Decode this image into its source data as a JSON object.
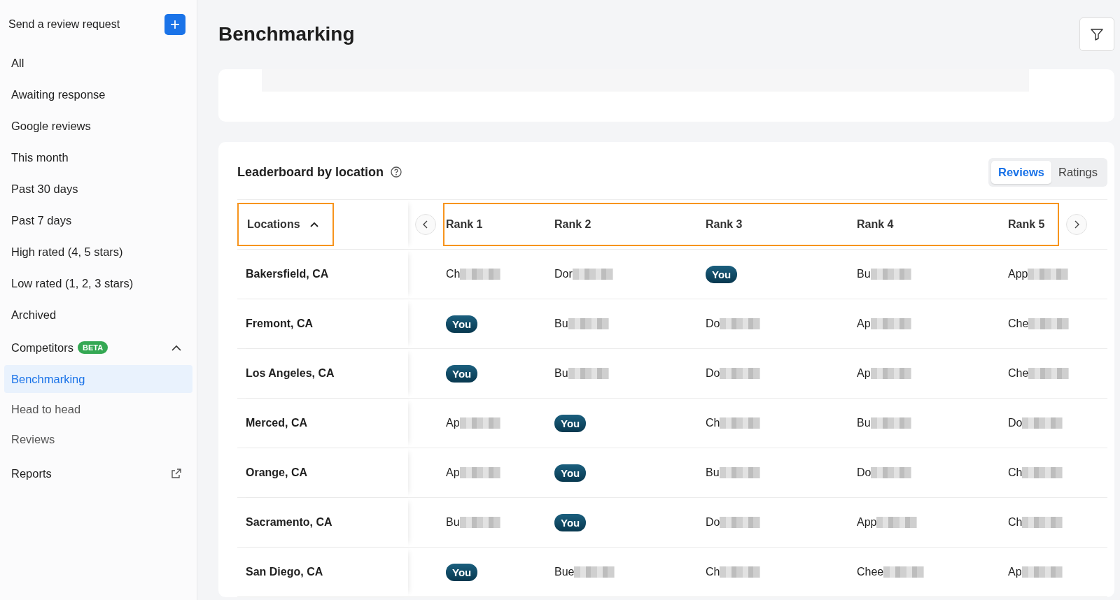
{
  "sidebar": {
    "send_request": {
      "label": "Send a review request",
      "button": "+"
    },
    "items": [
      {
        "label": "All",
        "selected": false
      },
      {
        "label": "Awaiting response",
        "selected": false
      },
      {
        "label": "Google reviews",
        "selected": false
      },
      {
        "label": "This month",
        "selected": false
      },
      {
        "label": "Past 30 days",
        "selected": false
      },
      {
        "label": "Past 7 days",
        "selected": false
      },
      {
        "label": "High rated (4, 5 stars)",
        "selected": false
      },
      {
        "label": "Low rated (1, 2, 3 stars)",
        "selected": false
      },
      {
        "label": "Archived",
        "selected": false
      }
    ],
    "competitors": {
      "label": "Competitors",
      "badge": "BETA",
      "expanded": true,
      "children": [
        {
          "label": "Benchmarking",
          "selected": true
        },
        {
          "label": "Head to head",
          "selected": false
        },
        {
          "label": "Reviews",
          "selected": false
        }
      ]
    },
    "reports": {
      "label": "Reports"
    }
  },
  "page": {
    "title": "Benchmarking"
  },
  "leaderboard": {
    "title": "Leaderboard by location",
    "tabs": [
      {
        "label": "Reviews",
        "selected": true
      },
      {
        "label": "Ratings",
        "selected": false
      }
    ],
    "location_column": "Locations",
    "rank_columns": [
      "Rank 1",
      "Rank 2",
      "Rank 3",
      "Rank 4",
      "Rank 5"
    ],
    "rows": [
      {
        "location": "Bakersfield, CA",
        "ranks": [
          {
            "kind": "name",
            "text": "Ch",
            "redacted": true
          },
          {
            "kind": "name",
            "text": "Dor",
            "redacted": true
          },
          {
            "kind": "you",
            "text": "You"
          },
          {
            "kind": "name",
            "text": "Bu",
            "redacted": true
          },
          {
            "kind": "name",
            "text": "App",
            "redacted": true
          }
        ]
      },
      {
        "location": "Fremont, CA",
        "ranks": [
          {
            "kind": "you",
            "text": "You"
          },
          {
            "kind": "name",
            "text": "Bu",
            "redacted": true
          },
          {
            "kind": "name",
            "text": "Do",
            "redacted": true
          },
          {
            "kind": "name",
            "text": "Ap",
            "redacted": true
          },
          {
            "kind": "name",
            "text": "Che",
            "redacted": true
          }
        ]
      },
      {
        "location": "Los Angeles, CA",
        "ranks": [
          {
            "kind": "you",
            "text": "You"
          },
          {
            "kind": "name",
            "text": "Bu",
            "redacted": true
          },
          {
            "kind": "name",
            "text": "Do",
            "redacted": true
          },
          {
            "kind": "name",
            "text": "Ap",
            "redacted": true
          },
          {
            "kind": "name",
            "text": "Che",
            "redacted": true
          }
        ]
      },
      {
        "location": "Merced, CA",
        "ranks": [
          {
            "kind": "name",
            "text": "Ap",
            "redacted": true
          },
          {
            "kind": "you",
            "text": "You"
          },
          {
            "kind": "name",
            "text": "Ch",
            "redacted": true
          },
          {
            "kind": "name",
            "text": "Bu",
            "redacted": true
          },
          {
            "kind": "name",
            "text": "Do",
            "redacted": true
          }
        ]
      },
      {
        "location": "Orange, CA",
        "ranks": [
          {
            "kind": "name",
            "text": "Ap",
            "redacted": true
          },
          {
            "kind": "you",
            "text": "You"
          },
          {
            "kind": "name",
            "text": "Bu",
            "redacted": true
          },
          {
            "kind": "name",
            "text": "Do",
            "redacted": true
          },
          {
            "kind": "name",
            "text": "Ch",
            "redacted": true
          }
        ]
      },
      {
        "location": "Sacramento, CA",
        "ranks": [
          {
            "kind": "name",
            "text": "Bu",
            "redacted": true
          },
          {
            "kind": "you",
            "text": "You"
          },
          {
            "kind": "name",
            "text": "Do",
            "redacted": true
          },
          {
            "kind": "name",
            "text": "App",
            "redacted": true
          },
          {
            "kind": "name",
            "text": "Ch",
            "redacted": true
          }
        ]
      },
      {
        "location": "San Diego, CA",
        "ranks": [
          {
            "kind": "you",
            "text": "You"
          },
          {
            "kind": "name",
            "text": "Bue",
            "redacted": true
          },
          {
            "kind": "name",
            "text": "Ch",
            "redacted": true
          },
          {
            "kind": "name",
            "text": "Chee",
            "redacted": true
          },
          {
            "kind": "name",
            "text": "Ap",
            "redacted": true
          }
        ]
      }
    ]
  }
}
